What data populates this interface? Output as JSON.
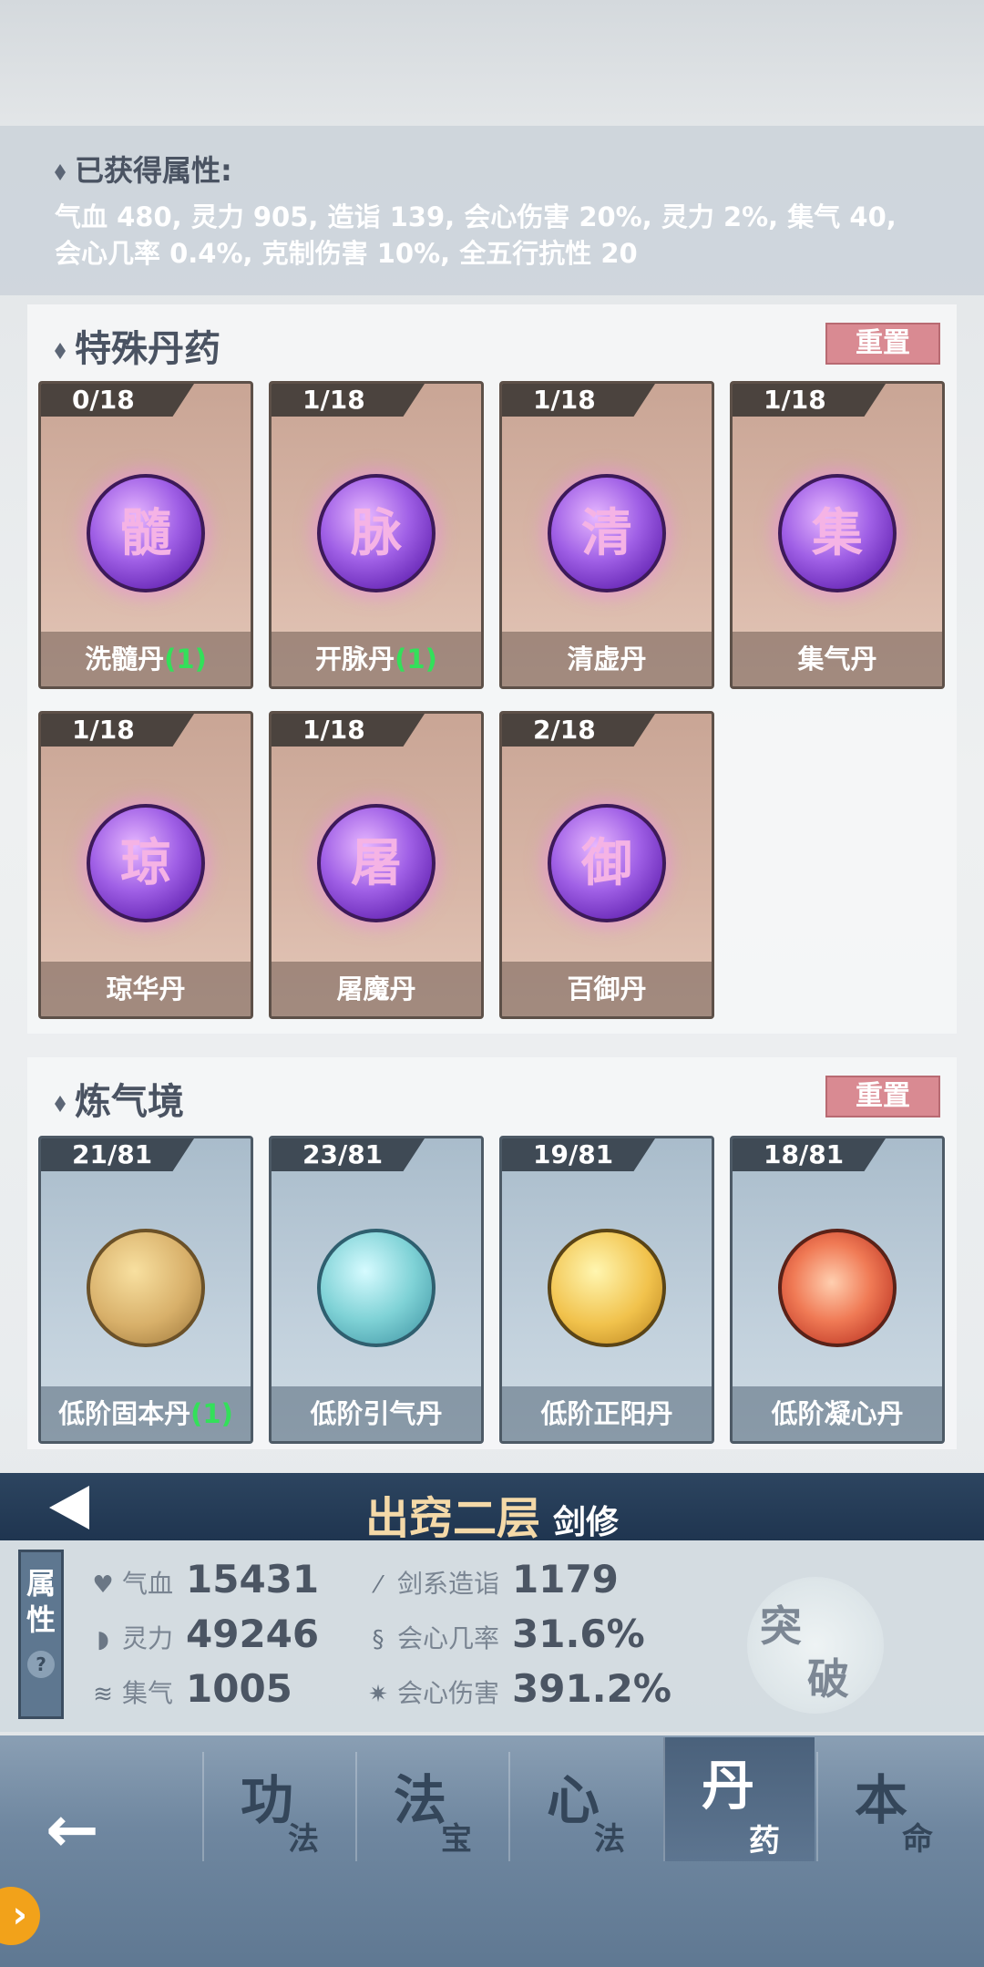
{
  "attributes_summary": {
    "header": "已获得属性:",
    "text": "气血 480, 灵力 905, 造诣 139, 会心伤害 20%, 灵力 2%, 集气 40, 会心几率 0.4%, 克制伤害 10%, 全五行抗性 20"
  },
  "special_pills": {
    "title": "特殊丹药",
    "reset_label": "重置",
    "items": [
      {
        "count": "0/18",
        "glyph": "髓",
        "name": "洗髓丹",
        "bonus": "(1)"
      },
      {
        "count": "1/18",
        "glyph": "脉",
        "name": "开脉丹",
        "bonus": "(1)"
      },
      {
        "count": "1/18",
        "glyph": "清",
        "name": "清虚丹",
        "bonus": ""
      },
      {
        "count": "1/18",
        "glyph": "集",
        "name": "集气丹",
        "bonus": ""
      },
      {
        "count": "1/18",
        "glyph": "琼",
        "name": "琼华丹",
        "bonus": ""
      },
      {
        "count": "1/18",
        "glyph": "屠",
        "name": "屠魔丹",
        "bonus": ""
      },
      {
        "count": "2/18",
        "glyph": "御",
        "name": "百御丹",
        "bonus": ""
      }
    ]
  },
  "qi_realm": {
    "title": "炼气境",
    "reset_label": "重置",
    "items": [
      {
        "count": "21/81",
        "name": "低阶固本丹",
        "bonus": "(1)",
        "orb": "gold"
      },
      {
        "count": "23/81",
        "name": "低阶引气丹",
        "bonus": "",
        "orb": "teal"
      },
      {
        "count": "19/81",
        "name": "低阶正阳丹",
        "bonus": "",
        "orb": "yellow"
      },
      {
        "count": "18/81",
        "name": "低阶凝心丹",
        "bonus": "",
        "orb": "red"
      }
    ]
  },
  "realm": {
    "title": "出窍二层",
    "subtitle": "剑修"
  },
  "stats": {
    "tab_label_1": "属",
    "tab_label_2": "性",
    "help": "?",
    "hp": {
      "label": "气血",
      "value": "15431"
    },
    "mana": {
      "label": "灵力",
      "value": "49246"
    },
    "gather": {
      "label": "集气",
      "value": "1005"
    },
    "mastery": {
      "label": "剑系造诣",
      "value": "1179"
    },
    "crit_rate": {
      "label": "会心几率",
      "value": "31.6%"
    },
    "crit_dmg": {
      "label": "会心伤害",
      "value": "391.2%"
    },
    "breakthrough_1": "突",
    "breakthrough_2": "破"
  },
  "nav": {
    "tabs": [
      {
        "big": "功",
        "small": "法"
      },
      {
        "big": "法",
        "small": "宝"
      },
      {
        "big": "心",
        "small": "法"
      },
      {
        "big": "丹",
        "small": "药"
      },
      {
        "big": "本",
        "small": "命"
      }
    ]
  }
}
